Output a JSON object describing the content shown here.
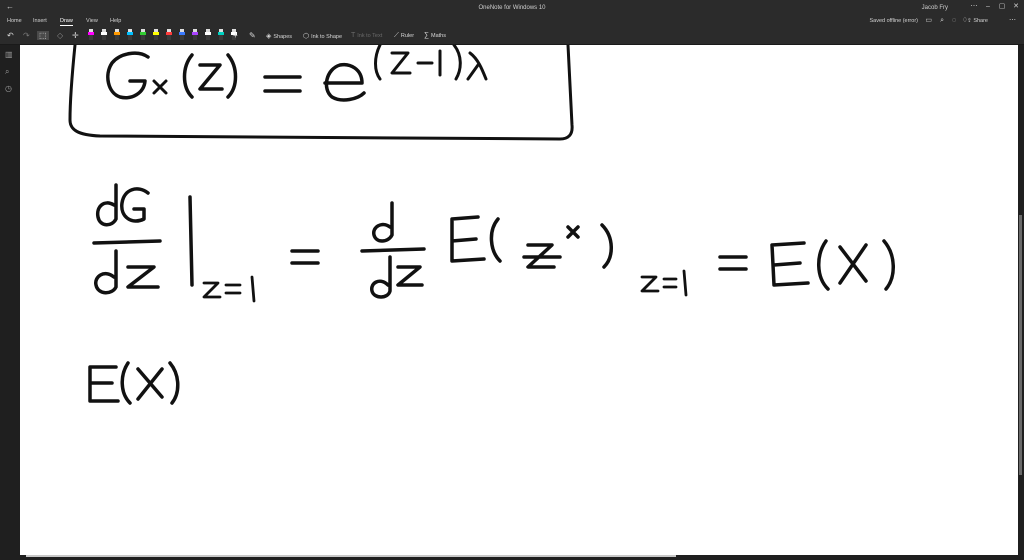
{
  "window": {
    "title": "OneNote for Windows 10",
    "user": "Jacob Fry"
  },
  "menu": {
    "tabs": [
      "Home",
      "Insert",
      "Draw",
      "View",
      "Help"
    ],
    "active_tab": "Draw",
    "status": "Saved offline (error)",
    "share_label": "Share"
  },
  "toolbar": {
    "shapes_label": "Shapes",
    "ink_to_shape_label": "Ink to Shape",
    "ink_to_text_label": "Ink to Text",
    "ruler_label": "Ruler",
    "maths_label": "Maths",
    "pens": [
      {
        "color": "#ff00ff"
      },
      {
        "color": "#ffffff"
      },
      {
        "color": "#ff9900"
      },
      {
        "color": "#00c0ff"
      },
      {
        "color": "#33cc33"
      },
      {
        "color": "#ffff00"
      },
      {
        "color": "#ff3b3b"
      },
      {
        "color": "#3b7bff"
      },
      {
        "color": "#aa44ff"
      },
      {
        "color": "#ffffff"
      },
      {
        "color": "#00d0c0"
      },
      {
        "color": "#ffffff"
      }
    ]
  },
  "sidebar": {
    "icons": [
      "notebooks-icon",
      "search-icon",
      "recent-icon"
    ]
  },
  "page": {
    "ink_color": "#111111",
    "background": "#ffffff"
  }
}
